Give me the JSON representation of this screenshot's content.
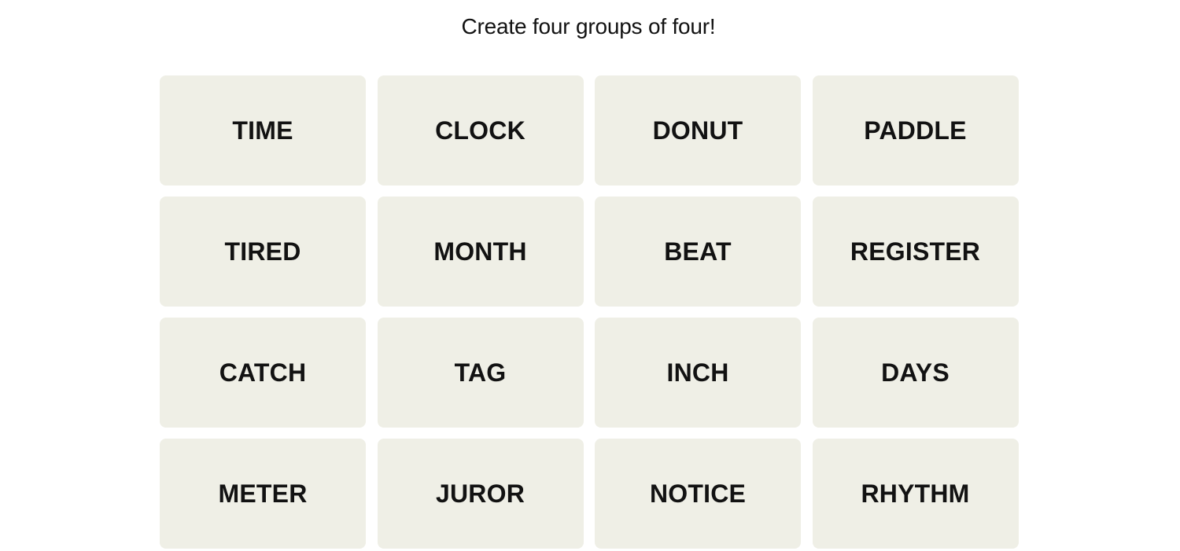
{
  "header": {
    "subtitle": "Create four groups of four!"
  },
  "board": {
    "tiles": [
      "TIME",
      "CLOCK",
      "DONUT",
      "PADDLE",
      "TIRED",
      "MONTH",
      "BEAT",
      "REGISTER",
      "CATCH",
      "TAG",
      "INCH",
      "DAYS",
      "METER",
      "JUROR",
      "NOTICE",
      "RHYTHM"
    ]
  },
  "colors": {
    "tile_bg": "#efefe6",
    "text": "#121212"
  }
}
